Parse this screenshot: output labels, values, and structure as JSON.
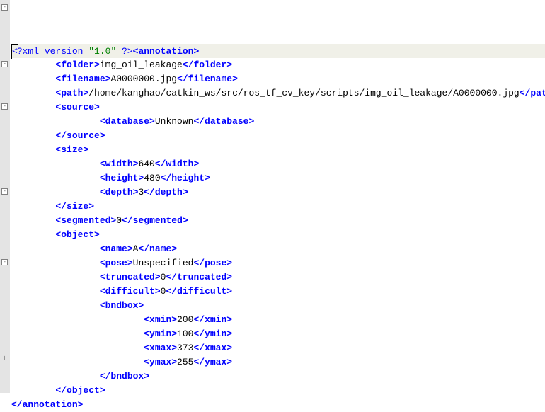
{
  "lines": [
    {
      "indent": 0,
      "fold": "open",
      "highlighted": true,
      "segments": [
        {
          "cls": "pi cursor-box",
          "text": "<"
        },
        {
          "cls": "pi",
          "text": "?xml version="
        },
        {
          "cls": "attr-val",
          "text": "\"1.0\""
        },
        {
          "cls": "pi",
          "text": " ?>"
        },
        {
          "cls": "tag",
          "text": "<annotation>"
        }
      ]
    },
    {
      "indent": 2,
      "segments": [
        {
          "cls": "tag",
          "text": "<folder>"
        },
        {
          "cls": "text",
          "text": "img_oil_leakage"
        },
        {
          "cls": "tag",
          "text": "</folder>"
        }
      ]
    },
    {
      "indent": 2,
      "segments": [
        {
          "cls": "tag",
          "text": "<filename>"
        },
        {
          "cls": "text",
          "text": "A0000000.jpg"
        },
        {
          "cls": "tag",
          "text": "</filename>"
        }
      ]
    },
    {
      "indent": 2,
      "segments": [
        {
          "cls": "tag",
          "text": "<path>"
        },
        {
          "cls": "text",
          "text": "/home/kanghao/catkin_ws/src/ros_tf_cv_key/scripts/img_oil_leakage/A0000000.jpg"
        },
        {
          "cls": "tag",
          "text": "</path>"
        }
      ]
    },
    {
      "indent": 2,
      "fold": "open",
      "segments": [
        {
          "cls": "tag",
          "text": "<source>"
        }
      ]
    },
    {
      "indent": 4,
      "segments": [
        {
          "cls": "tag",
          "text": "<database>"
        },
        {
          "cls": "text",
          "text": "Unknown"
        },
        {
          "cls": "tag",
          "text": "</database>"
        }
      ]
    },
    {
      "indent": 2,
      "segments": [
        {
          "cls": "tag",
          "text": "</source>"
        }
      ]
    },
    {
      "indent": 2,
      "fold": "open",
      "segments": [
        {
          "cls": "tag",
          "text": "<size>"
        }
      ]
    },
    {
      "indent": 4,
      "segments": [
        {
          "cls": "tag",
          "text": "<width>"
        },
        {
          "cls": "text",
          "text": "640"
        },
        {
          "cls": "tag",
          "text": "</width>"
        }
      ]
    },
    {
      "indent": 4,
      "segments": [
        {
          "cls": "tag",
          "text": "<height>"
        },
        {
          "cls": "text",
          "text": "480"
        },
        {
          "cls": "tag",
          "text": "</height>"
        }
      ]
    },
    {
      "indent": 4,
      "segments": [
        {
          "cls": "tag",
          "text": "<depth>"
        },
        {
          "cls": "text",
          "text": "3"
        },
        {
          "cls": "tag",
          "text": "</depth>"
        }
      ]
    },
    {
      "indent": 2,
      "segments": [
        {
          "cls": "tag",
          "text": "</size>"
        }
      ]
    },
    {
      "indent": 2,
      "segments": [
        {
          "cls": "tag",
          "text": "<segmented>"
        },
        {
          "cls": "text",
          "text": "0"
        },
        {
          "cls": "tag",
          "text": "</segmented>"
        }
      ]
    },
    {
      "indent": 2,
      "fold": "open",
      "segments": [
        {
          "cls": "tag",
          "text": "<object>"
        }
      ]
    },
    {
      "indent": 4,
      "segments": [
        {
          "cls": "tag",
          "text": "<name>"
        },
        {
          "cls": "text",
          "text": "A"
        },
        {
          "cls": "tag",
          "text": "</name>"
        }
      ]
    },
    {
      "indent": 4,
      "segments": [
        {
          "cls": "tag",
          "text": "<pose>"
        },
        {
          "cls": "text",
          "text": "Unspecified"
        },
        {
          "cls": "tag",
          "text": "</pose>"
        }
      ]
    },
    {
      "indent": 4,
      "segments": [
        {
          "cls": "tag",
          "text": "<truncated>"
        },
        {
          "cls": "text",
          "text": "0"
        },
        {
          "cls": "tag",
          "text": "</truncated>"
        }
      ]
    },
    {
      "indent": 4,
      "segments": [
        {
          "cls": "tag",
          "text": "<difficult>"
        },
        {
          "cls": "text",
          "text": "0"
        },
        {
          "cls": "tag",
          "text": "</difficult>"
        }
      ]
    },
    {
      "indent": 4,
      "fold": "open",
      "segments": [
        {
          "cls": "tag",
          "text": "<bndbox>"
        }
      ]
    },
    {
      "indent": 6,
      "segments": [
        {
          "cls": "tag",
          "text": "<xmin>"
        },
        {
          "cls": "text",
          "text": "200"
        },
        {
          "cls": "tag",
          "text": "</xmin>"
        }
      ]
    },
    {
      "indent": 6,
      "segments": [
        {
          "cls": "tag",
          "text": "<ymin>"
        },
        {
          "cls": "text",
          "text": "100"
        },
        {
          "cls": "tag",
          "text": "</ymin>"
        }
      ]
    },
    {
      "indent": 6,
      "segments": [
        {
          "cls": "tag",
          "text": "<xmax>"
        },
        {
          "cls": "text",
          "text": "373"
        },
        {
          "cls": "tag",
          "text": "</xmax>"
        }
      ]
    },
    {
      "indent": 6,
      "segments": [
        {
          "cls": "tag",
          "text": "<ymax>"
        },
        {
          "cls": "text",
          "text": "255"
        },
        {
          "cls": "tag",
          "text": "</ymax>"
        }
      ]
    },
    {
      "indent": 4,
      "segments": [
        {
          "cls": "tag",
          "text": "</bndbox>"
        }
      ]
    },
    {
      "indent": 2,
      "segments": [
        {
          "cls": "tag",
          "text": "</object>"
        }
      ]
    },
    {
      "indent": 0,
      "endfold": true,
      "segments": [
        {
          "cls": "tag",
          "text": "</annotation>"
        }
      ]
    }
  ],
  "fold_glyph_open": "-",
  "indent_unit": "    "
}
